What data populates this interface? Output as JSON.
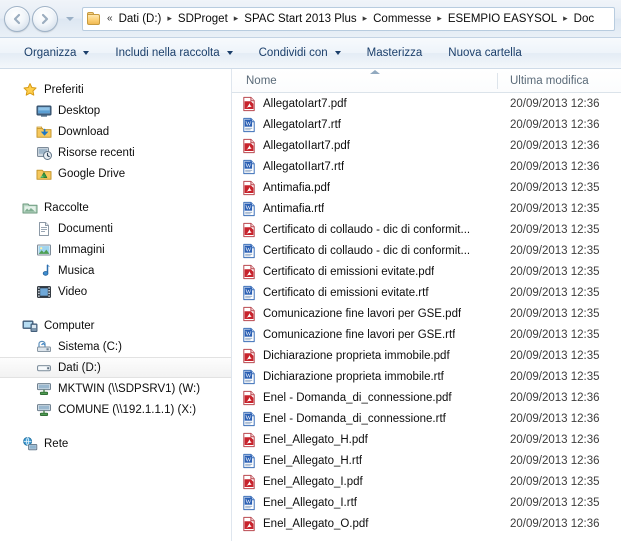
{
  "window": {
    "nav": {
      "back_label": "Indietro",
      "forward_label": "Avanti",
      "history_label": "Pagine recenti",
      "folder_icon": "folder-icon",
      "overflow_chevron": "«",
      "separator": "▸",
      "breadcrumbs": [
        "Dati (D:)",
        "SDProget",
        "SPAC Start 2013 Plus",
        "Commesse",
        "ESEMPIO EASYSOL",
        "Doc"
      ]
    },
    "toolbar": {
      "items": [
        {
          "label": "Organizza",
          "has_caret": true
        },
        {
          "label": "Includi nella raccolta",
          "has_caret": true
        },
        {
          "label": "Condividi con",
          "has_caret": true
        },
        {
          "label": "Masterizza",
          "has_caret": false
        },
        {
          "label": "Nuova cartella",
          "has_caret": false
        }
      ]
    },
    "sidebar": {
      "groups": [
        {
          "header": {
            "label": "Preferiti",
            "icon": "star-icon"
          },
          "items": [
            {
              "label": "Desktop",
              "icon": "desktop-icon"
            },
            {
              "label": "Download",
              "icon": "download-folder-icon"
            },
            {
              "label": "Risorse recenti",
              "icon": "recent-places-icon"
            },
            {
              "label": "Google Drive",
              "icon": "google-drive-icon"
            }
          ]
        },
        {
          "header": {
            "label": "Raccolte",
            "icon": "libraries-icon"
          },
          "items": [
            {
              "label": "Documenti",
              "icon": "documents-icon"
            },
            {
              "label": "Immagini",
              "icon": "pictures-icon"
            },
            {
              "label": "Musica",
              "icon": "music-icon"
            },
            {
              "label": "Video",
              "icon": "video-icon"
            }
          ]
        },
        {
          "header": {
            "label": "Computer",
            "icon": "computer-icon"
          },
          "items": [
            {
              "label": "Sistema (C:)",
              "icon": "system-drive-icon",
              "selected": false
            },
            {
              "label": "Dati (D:)",
              "icon": "hard-drive-icon",
              "selected": true
            },
            {
              "label": "MKTWIN (\\\\SDPSRV1) (W:)",
              "icon": "network-drive-icon",
              "selected": false
            },
            {
              "label": "COMUNE (\\\\192.1.1.1) (X:)",
              "icon": "network-drive-icon",
              "selected": false
            }
          ]
        },
        {
          "header": {
            "label": "Rete",
            "icon": "network-icon"
          },
          "items": []
        }
      ]
    },
    "filelist": {
      "columns": {
        "name": "Nome",
        "modified": "Ultima modifica"
      },
      "sort": {
        "column": "Nome",
        "direction": "ascending"
      },
      "rows": [
        {
          "name": "AllegatoIart7.pdf",
          "type": "pdf",
          "modified": "20/09/2013 12:36"
        },
        {
          "name": "AllegatoIart7.rtf",
          "type": "rtf",
          "modified": "20/09/2013 12:36"
        },
        {
          "name": "AllegatoIIart7.pdf",
          "type": "pdf",
          "modified": "20/09/2013 12:36"
        },
        {
          "name": "AllegatoIIart7.rtf",
          "type": "rtf",
          "modified": "20/09/2013 12:36"
        },
        {
          "name": "Antimafia.pdf",
          "type": "pdf",
          "modified": "20/09/2013 12:35"
        },
        {
          "name": "Antimafia.rtf",
          "type": "rtf",
          "modified": "20/09/2013 12:35"
        },
        {
          "name": "Certificato di collaudo - dic di conformit...",
          "type": "pdf",
          "modified": "20/09/2013 12:35"
        },
        {
          "name": "Certificato di collaudo - dic di conformit...",
          "type": "rtf",
          "modified": "20/09/2013 12:35"
        },
        {
          "name": "Certificato di emissioni evitate.pdf",
          "type": "pdf",
          "modified": "20/09/2013 12:35"
        },
        {
          "name": "Certificato di emissioni evitate.rtf",
          "type": "rtf",
          "modified": "20/09/2013 12:35"
        },
        {
          "name": "Comunicazione fine lavori per GSE.pdf",
          "type": "pdf",
          "modified": "20/09/2013 12:35"
        },
        {
          "name": "Comunicazione fine lavori per GSE.rtf",
          "type": "rtf",
          "modified": "20/09/2013 12:35"
        },
        {
          "name": "Dichiarazione proprieta immobile.pdf",
          "type": "pdf",
          "modified": "20/09/2013 12:35"
        },
        {
          "name": "Dichiarazione proprieta immobile.rtf",
          "type": "rtf",
          "modified": "20/09/2013 12:35"
        },
        {
          "name": "Enel - Domanda_di_connessione.pdf",
          "type": "pdf",
          "modified": "20/09/2013 12:36"
        },
        {
          "name": "Enel - Domanda_di_connessione.rtf",
          "type": "rtf",
          "modified": "20/09/2013 12:36"
        },
        {
          "name": "Enel_Allegato_H.pdf",
          "type": "pdf",
          "modified": "20/09/2013 12:36"
        },
        {
          "name": "Enel_Allegato_H.rtf",
          "type": "rtf",
          "modified": "20/09/2013 12:36"
        },
        {
          "name": "Enel_Allegato_I.pdf",
          "type": "pdf",
          "modified": "20/09/2013 12:35"
        },
        {
          "name": "Enel_Allegato_I.rtf",
          "type": "rtf",
          "modified": "20/09/2013 12:35"
        },
        {
          "name": "Enel_Allegato_O.pdf",
          "type": "pdf",
          "modified": "20/09/2013 12:36"
        }
      ]
    },
    "colors": {
      "pdf_red": "#c8232c",
      "rtf_blue": "#2a5fb4",
      "toolbar_text": "#1b3f6b",
      "header_text": "#5a6a78",
      "chrome": "#e6edf5"
    }
  }
}
